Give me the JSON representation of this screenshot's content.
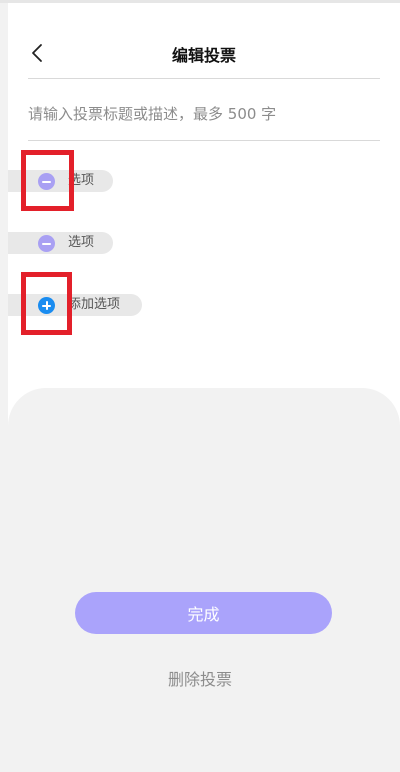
{
  "header": {
    "title": "编辑投票"
  },
  "description": {
    "placeholder": "请输入投票标题或描述，最多 500 字",
    "value": ""
  },
  "options": [
    {
      "label": "选项"
    },
    {
      "label": "选项"
    }
  ],
  "add_option": {
    "label": "添加选项"
  },
  "footer": {
    "done_label": "完成",
    "delete_label": "删除投票"
  },
  "colors": {
    "accent": "#aaa3fb",
    "remove_icon": "#a9a0f3",
    "add_icon": "#1a8cf0",
    "highlight": "#e3202a",
    "panel": "#f2f2f2"
  }
}
